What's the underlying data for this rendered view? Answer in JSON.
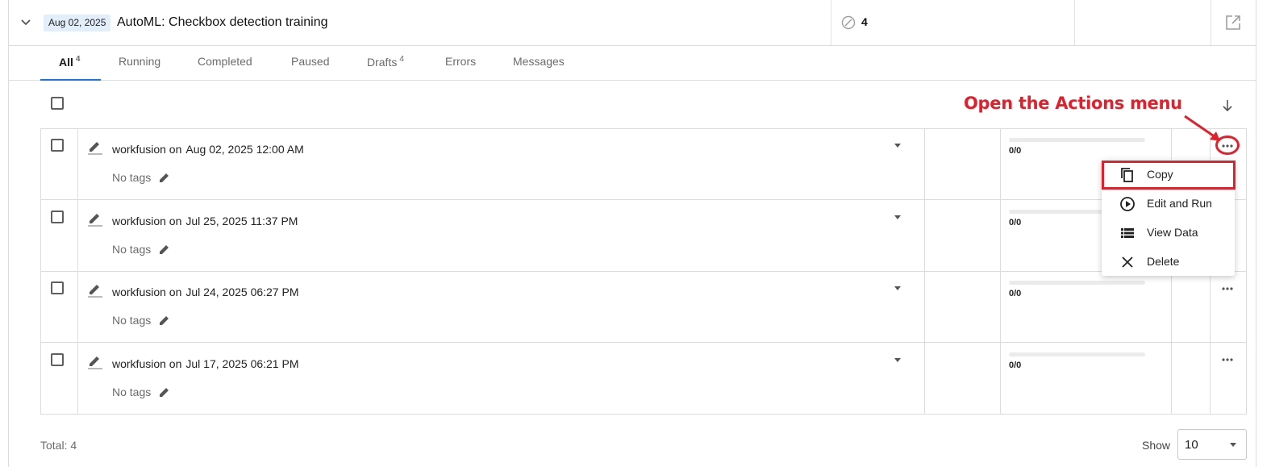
{
  "header": {
    "date_badge": "Aug 02, 2025",
    "title": "AutoML: Checkbox detection training",
    "status_count": "4"
  },
  "tabs": [
    {
      "label": "All",
      "count": "4",
      "active": true
    },
    {
      "label": "Running",
      "count": ""
    },
    {
      "label": "Completed",
      "count": ""
    },
    {
      "label": "Paused",
      "count": ""
    },
    {
      "label": "Drafts",
      "count": "4"
    },
    {
      "label": "Errors",
      "count": ""
    },
    {
      "label": "Messages",
      "count": ""
    }
  ],
  "rows": [
    {
      "user": "workfusion on",
      "datetime": "Aug 02, 2025 12:00 AM",
      "tags": "No tags",
      "progress": "0/0"
    },
    {
      "user": "workfusion on",
      "datetime": "Jul 25, 2025 11:37 PM",
      "tags": "No tags",
      "progress": "0/0"
    },
    {
      "user": "workfusion on",
      "datetime": "Jul 24, 2025 06:27 PM",
      "tags": "No tags",
      "progress": "0/0"
    },
    {
      "user": "workfusion on",
      "datetime": "Jul 17, 2025 06:21 PM",
      "tags": "No tags",
      "progress": "0/0"
    }
  ],
  "actions_menu": {
    "items": [
      {
        "label": "Copy",
        "icon": "copy-icon"
      },
      {
        "label": "Edit and Run",
        "icon": "play-circle-icon"
      },
      {
        "label": "View Data",
        "icon": "list-icon"
      },
      {
        "label": "Delete",
        "icon": "close-icon"
      }
    ]
  },
  "annotation": {
    "text": "Open the Actions menu",
    "color": "#e2202c"
  },
  "footer": {
    "total": "Total: 4",
    "show_label": "Show",
    "show_value": "10"
  },
  "colors": {
    "accent": "#1a73e8",
    "date_badge_bg": "#e3eefb",
    "annotation_red": "#e2202c"
  }
}
